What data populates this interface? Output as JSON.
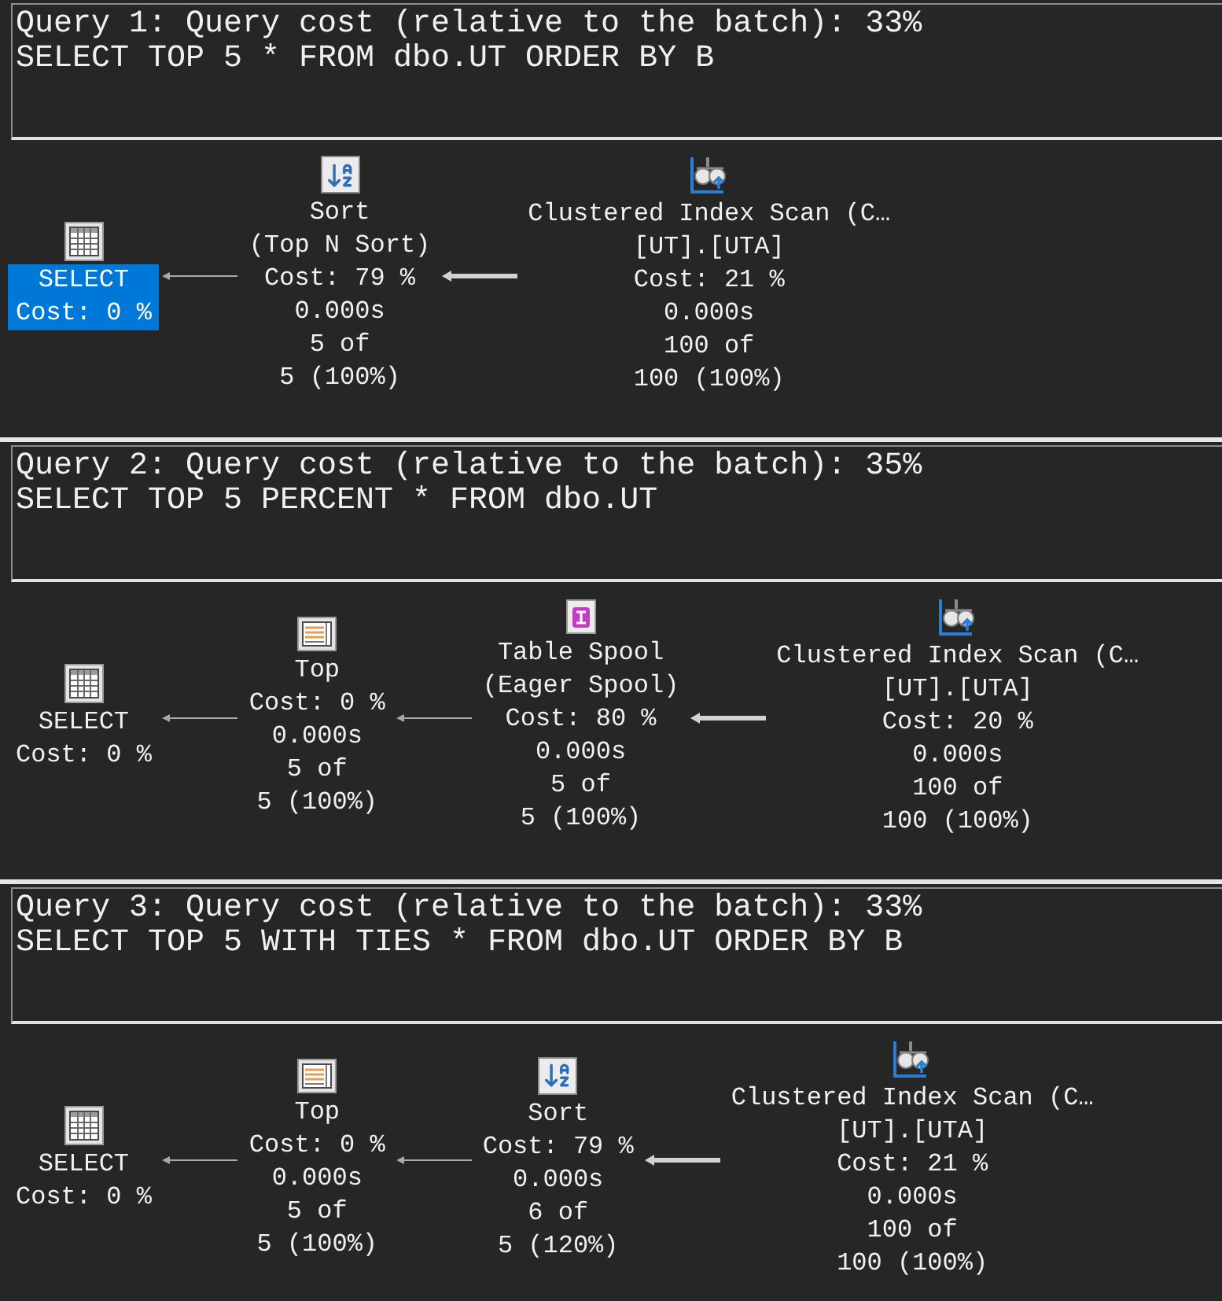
{
  "plans": [
    {
      "header": {
        "title": "Query 1: Query cost (relative to the batch): 33%",
        "sql": "SELECT TOP 5 * FROM dbo.UT ORDER BY B"
      },
      "operators": [
        {
          "kind": "select",
          "name": "SELECT",
          "cost": "Cost: 0 %",
          "selected": true
        },
        {
          "kind": "sort",
          "name": "Sort",
          "detail": "(Top N Sort)",
          "cost": "Cost: 79 %",
          "time": "0.000s",
          "actual_rows": "5 of",
          "estimated_rows": "5 (100%)",
          "selected": false
        },
        {
          "kind": "clustered_index_scan",
          "name": "Clustered Index Scan (C…",
          "object": "[UT].[UTA]",
          "cost": "Cost: 21 %",
          "time": "0.000s",
          "actual_rows": "100 of",
          "estimated_rows": "100 (100%)",
          "selected": false
        }
      ],
      "links": [
        {
          "kind": "thin"
        },
        {
          "kind": "thick"
        }
      ]
    },
    {
      "header": {
        "title": "Query 2: Query cost (relative to the batch): 35%",
        "sql": "SELECT TOP 5 PERCENT * FROM dbo.UT"
      },
      "operators": [
        {
          "kind": "select",
          "name": "SELECT",
          "cost": "Cost: 0 %",
          "selected": false
        },
        {
          "kind": "top",
          "name": "Top",
          "cost": "Cost: 0 %",
          "time": "0.000s",
          "actual_rows": "5 of",
          "estimated_rows": "5 (100%)",
          "selected": false
        },
        {
          "kind": "table_spool",
          "name": "Table Spool",
          "detail": "(Eager Spool)",
          "cost": "Cost: 80 %",
          "time": "0.000s",
          "actual_rows": "5 of",
          "estimated_rows": "5 (100%)",
          "selected": false
        },
        {
          "kind": "clustered_index_scan",
          "name": "Clustered Index Scan (C…",
          "object": "[UT].[UTA]",
          "cost": "Cost: 20 %",
          "time": "0.000s",
          "actual_rows": "100 of",
          "estimated_rows": "100 (100%)",
          "selected": false
        }
      ],
      "links": [
        {
          "kind": "thin"
        },
        {
          "kind": "thin"
        },
        {
          "kind": "thick"
        }
      ]
    },
    {
      "header": {
        "title": "Query 3: Query cost (relative to the batch): 33%",
        "sql": "SELECT TOP 5 WITH TIES * FROM dbo.UT ORDER BY B"
      },
      "operators": [
        {
          "kind": "select",
          "name": "SELECT",
          "cost": "Cost: 0 %",
          "selected": false
        },
        {
          "kind": "top",
          "name": "Top",
          "cost": "Cost: 0 %",
          "time": "0.000s",
          "actual_rows": "5 of",
          "estimated_rows": "5 (100%)",
          "selected": false
        },
        {
          "kind": "sort",
          "name": "Sort",
          "cost": "Cost: 79 %",
          "time": "0.000s",
          "actual_rows": "6 of",
          "estimated_rows": "5 (120%)",
          "selected": false
        },
        {
          "kind": "clustered_index_scan",
          "name": "Clustered Index Scan (C…",
          "object": "[UT].[UTA]",
          "cost": "Cost: 21 %",
          "time": "0.000s",
          "actual_rows": "100 of",
          "estimated_rows": "100 (100%)",
          "selected": false
        }
      ],
      "links": [
        {
          "kind": "thin"
        },
        {
          "kind": "thin"
        },
        {
          "kind": "thick"
        }
      ]
    }
  ]
}
